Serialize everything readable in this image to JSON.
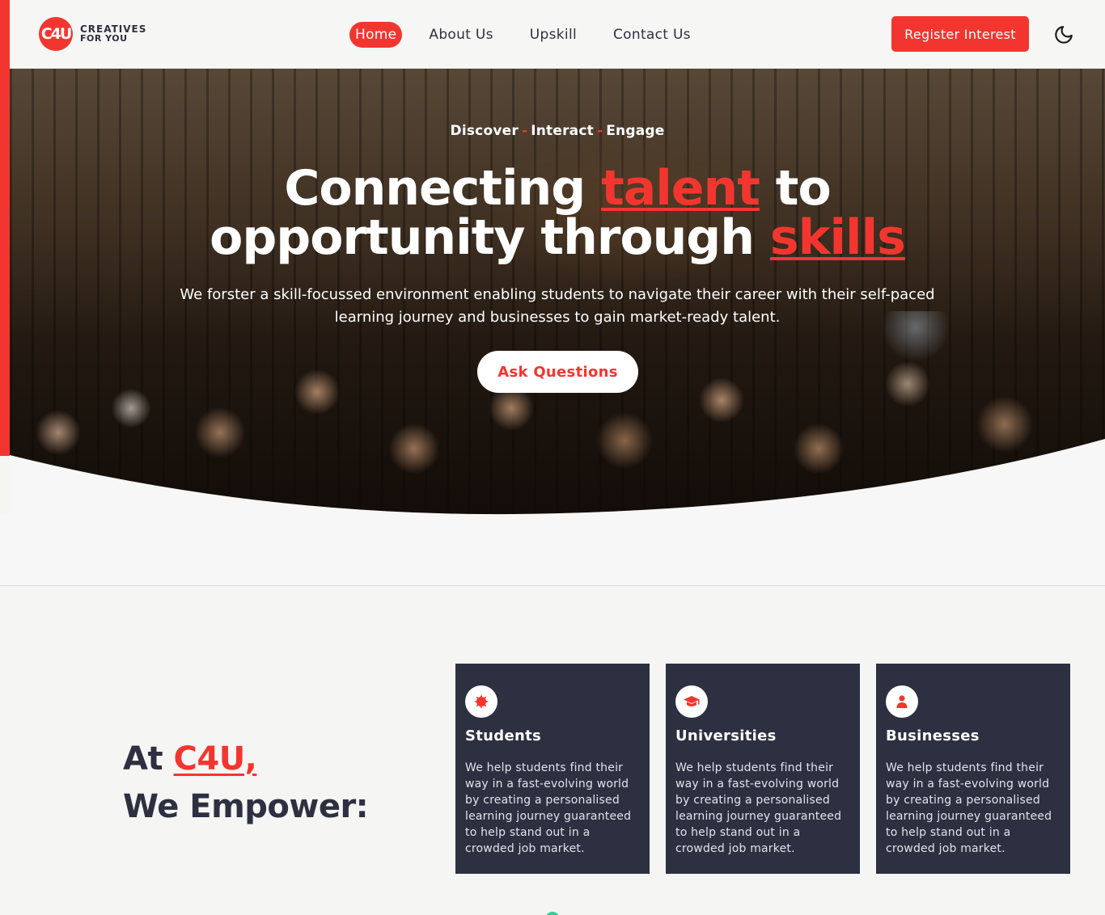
{
  "brand": {
    "logo_mark": "C4U",
    "name_line1": "CREATIVES",
    "name_line2": "FOR YOU",
    "accent_color": "#f2362f",
    "dark_color": "#2d3041"
  },
  "nav": {
    "items": [
      {
        "label": "Home",
        "active": true
      },
      {
        "label": "About Us",
        "active": false
      },
      {
        "label": "Upskill",
        "active": false
      },
      {
        "label": "Contact Us",
        "active": false
      }
    ],
    "register_label": "Register Interest",
    "theme_toggle_icon": "moon-icon"
  },
  "hero": {
    "tagline": [
      "Discover",
      "Interact",
      "Engage"
    ],
    "tagline_separator": "-",
    "headline_part1": "Connecting ",
    "headline_accent1": "talent",
    "headline_part2": " to",
    "headline_part3": "opportunity through ",
    "headline_accent2": "skills",
    "subtitle": "We forster a skill-focussed environment enabling students to navigate their career with their self-paced learning journey and businesses to gain market-ready talent.",
    "cta_label": "Ask Questions"
  },
  "empower": {
    "title_prefix": "At ",
    "title_brand": "C4U,",
    "title_line2": "We Empower:",
    "cards": [
      {
        "icon": "badge-icon",
        "title": "Students",
        "text": "We help students find their way in a fast-evolving world by creating a personalised learning journey guaranteed to help stand out in a crowded job market."
      },
      {
        "icon": "graduation-cap-icon",
        "title": "Universities",
        "text": "We help students find their way in a fast-evolving world by creating a personalised learning journey guaranteed to help stand out in a crowded job market."
      },
      {
        "icon": "user-icon",
        "title": "Businesses",
        "text": "We help students find their way in a fast-evolving world by creating a personalised learning journey guaranteed to help stand out in a crowded job market."
      }
    ]
  }
}
